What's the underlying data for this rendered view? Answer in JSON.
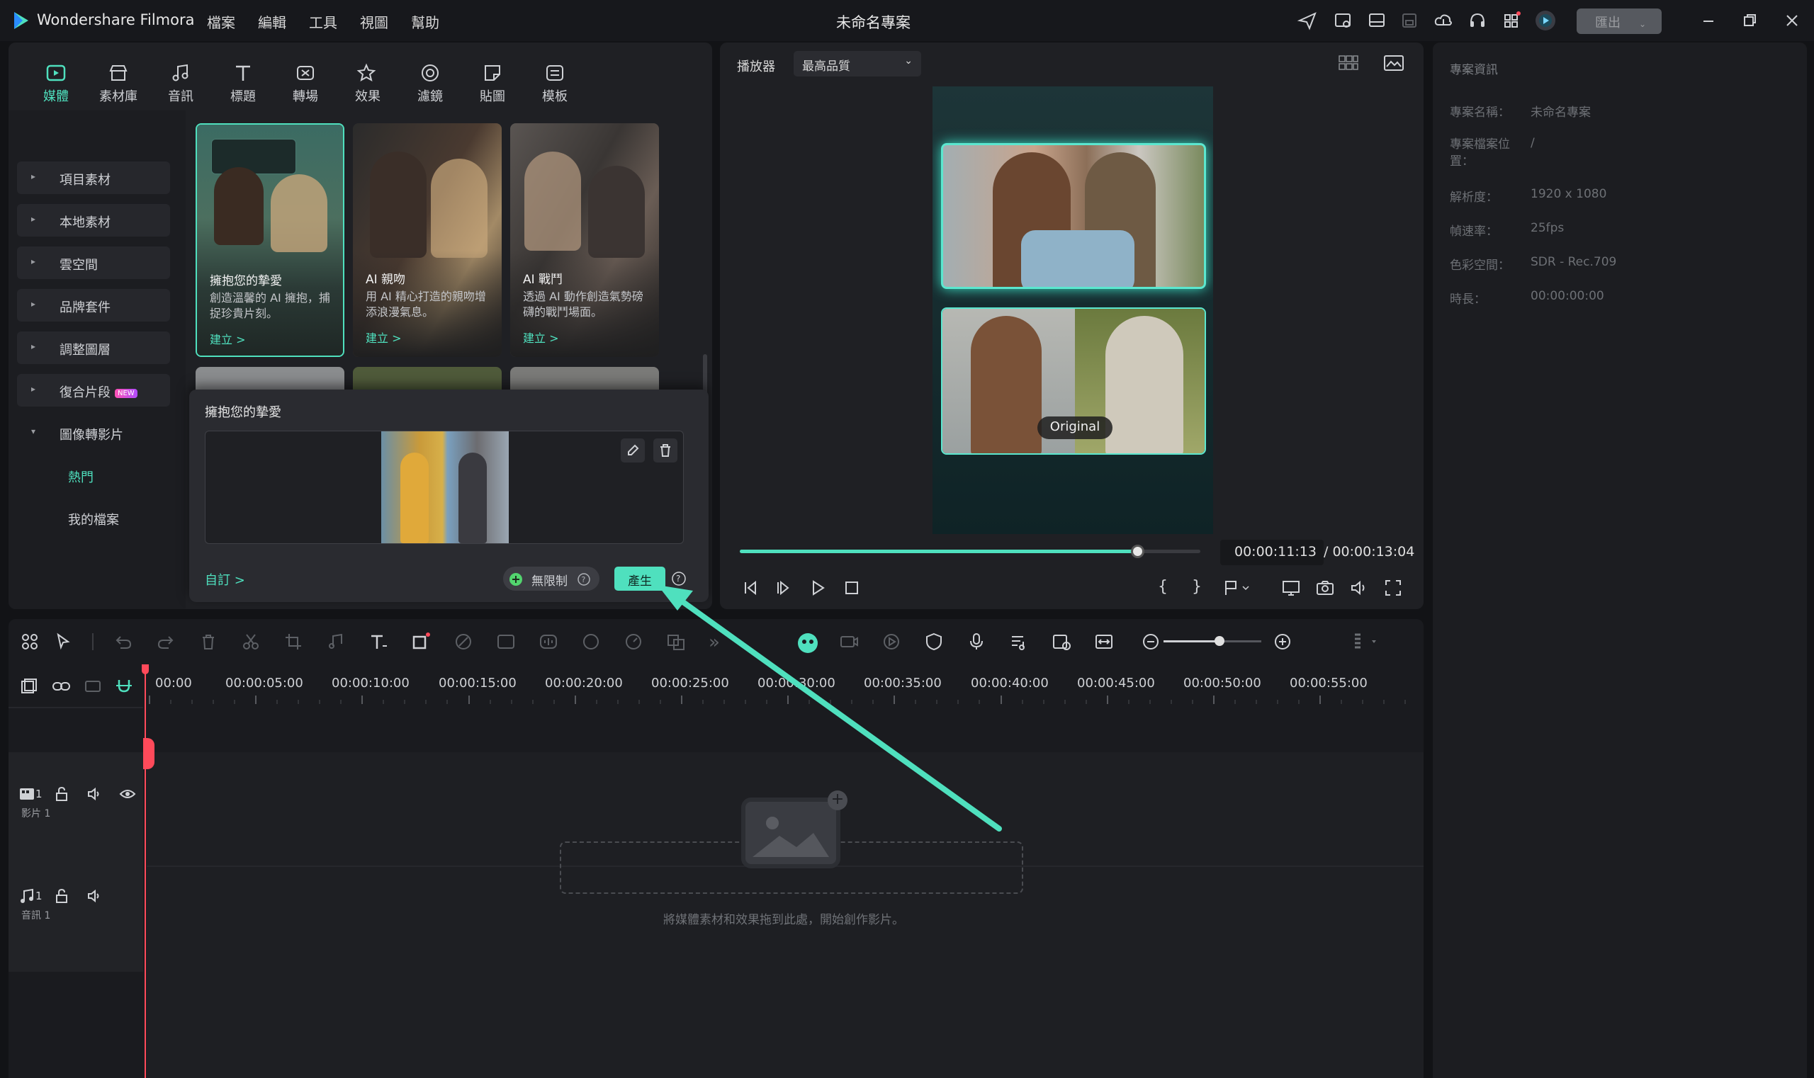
{
  "app": {
    "name": "Wondershare Filmora",
    "project_title": "未命名專案",
    "export_label": "匯出"
  },
  "menu": [
    "檔案",
    "編輯",
    "工具",
    "視圖",
    "幫助"
  ],
  "media_tabs": [
    {
      "label": "媒體",
      "icon": "media-icon",
      "active": true
    },
    {
      "label": "素材庫",
      "icon": "store-icon"
    },
    {
      "label": "音訊",
      "icon": "music-note-icon"
    },
    {
      "label": "標題",
      "icon": "text-t-icon"
    },
    {
      "label": "轉場",
      "icon": "transition-icon"
    },
    {
      "label": "效果",
      "icon": "effect-star-icon"
    },
    {
      "label": "濾鏡",
      "icon": "filter-icon"
    },
    {
      "label": "貼圖",
      "icon": "sticker-icon"
    },
    {
      "label": "模板",
      "icon": "template-icon"
    }
  ],
  "sidebar": {
    "categories": [
      "項目素材",
      "本地素材",
      "雲空間",
      "品牌套件",
      "調整圖層",
      "復合片段",
      "圖像轉影片"
    ],
    "new_badge": "NEW",
    "sub_items": [
      "熱門",
      "我的檔案"
    ]
  },
  "cards": [
    {
      "title": "擁抱您的摯愛",
      "desc": "創造溫馨的 AI 擁抱，捕捉珍貴片刻。",
      "link": "建立 >"
    },
    {
      "title": "AI 親吻",
      "desc": "用 AI 精心打造的親吻增添浪漫氣息。",
      "link": "建立 >"
    },
    {
      "title": "AI 戰鬥",
      "desc": "透過 AI 動作創造氣勢磅礴的戰鬥場面。",
      "link": "建立 >"
    }
  ],
  "popup": {
    "title": "擁抱您的摯愛",
    "custom_link": "自訂 >",
    "unlimited_label": "無限制",
    "generate_label": "產生"
  },
  "player": {
    "label": "播放器",
    "quality": "最高品質",
    "original_badge": "Original",
    "timecode": "00:00:11:13",
    "duration": "/ 00:00:13:04",
    "progress": 0.865
  },
  "project_info": {
    "header": "專案資訊",
    "rows": [
      {
        "key": "專案名稱：",
        "value": "未命名專案"
      },
      {
        "key": "專案檔案位置：",
        "value": "/"
      },
      {
        "key": "解析度：",
        "value": "1920 x 1080"
      },
      {
        "key": "幀速率：",
        "value": "25fps"
      },
      {
        "key": "色彩空間：",
        "value": "SDR - Rec.709"
      },
      {
        "key": "時長：",
        "value": "00:00:00:00"
      }
    ]
  },
  "timeline": {
    "ruler": [
      "00:00",
      "00:00:05:00",
      "00:00:10:00",
      "00:00:15:00",
      "00:00:20:00",
      "00:00:25:00",
      "00:00:30:00",
      "00:00:35:00",
      "00:00:40:00",
      "00:00:45:00",
      "00:00:50:00",
      "00:00:55:00"
    ],
    "tracks": [
      {
        "label": "影片 1",
        "num": "1"
      },
      {
        "label": "音訊 1",
        "num": "1"
      }
    ],
    "empty_hint": "將媒體素材和效果拖到此處，開始創作影片。"
  },
  "colors": {
    "accent": "#4fe0be",
    "playhead": "#ff4a5a",
    "bg": "#121316",
    "panel": "#1f2024"
  }
}
